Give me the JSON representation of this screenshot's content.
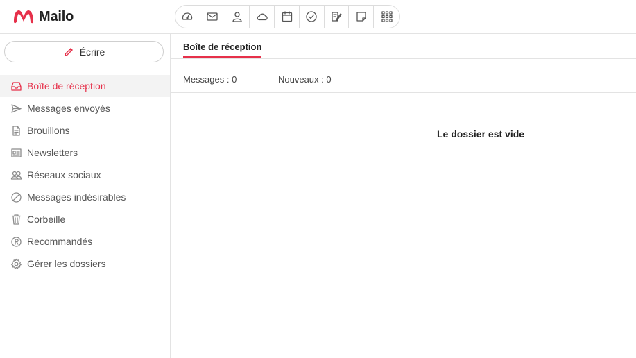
{
  "brand": {
    "name": "Mailo",
    "accent_color": "#e6304a"
  },
  "app_switcher": [
    {
      "icon": "dashboard-icon"
    },
    {
      "icon": "mail-icon"
    },
    {
      "icon": "contacts-icon"
    },
    {
      "icon": "cloud-icon"
    },
    {
      "icon": "calendar-icon"
    },
    {
      "icon": "tasks-icon"
    },
    {
      "icon": "notes-icon"
    },
    {
      "icon": "sticky-note-icon"
    },
    {
      "icon": "apps-grid-icon"
    }
  ],
  "compose": {
    "label": "Écrire"
  },
  "folders": [
    {
      "label": "Boîte de réception",
      "icon": "inbox-icon",
      "active": true
    },
    {
      "label": "Messages envoyés",
      "icon": "send-icon"
    },
    {
      "label": "Brouillons",
      "icon": "draft-icon"
    },
    {
      "label": "Newsletters",
      "icon": "newsletter-icon"
    },
    {
      "label": "Réseaux sociaux",
      "icon": "social-icon"
    },
    {
      "label": "Messages indésirables",
      "icon": "spam-icon"
    },
    {
      "label": "Corbeille",
      "icon": "trash-icon"
    },
    {
      "label": "Recommandés",
      "icon": "registered-icon"
    },
    {
      "label": "Gérer les dossiers",
      "icon": "gear-icon"
    }
  ],
  "main": {
    "tab_label": "Boîte de réception",
    "messages_count": "Messages : 0",
    "new_count": "Nouveaux : 0",
    "empty_text": "Le dossier est vide"
  }
}
